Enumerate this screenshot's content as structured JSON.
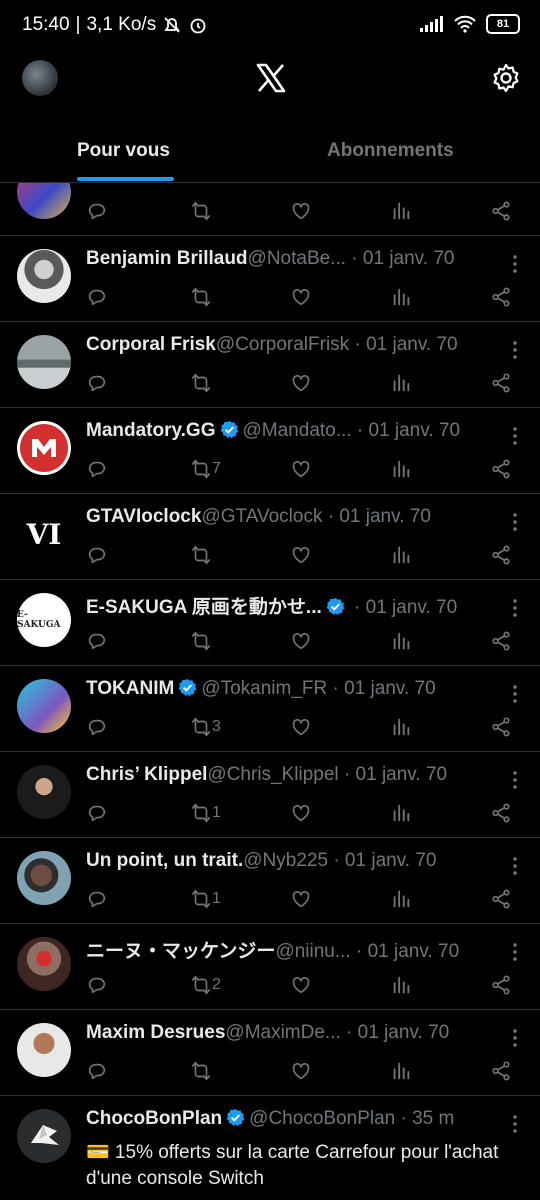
{
  "status_bar": {
    "time": "15:40",
    "network_speed": "3,1 Ko/s",
    "battery": "81"
  },
  "app": {
    "logo_icon": "x-logo",
    "settings_icon": "gear-icon"
  },
  "tabs": [
    {
      "label": "Pour vous",
      "active": true
    },
    {
      "label": "Abonnements",
      "active": false
    }
  ],
  "tweets": [
    {
      "name": "Benjamin Brillaud",
      "handle": "@NotaBe...",
      "date": " · 01 janv. 70",
      "retweets": ""
    },
    {
      "name": "Corporal Frisk",
      "handle": "@CorporalFrisk",
      "date": " · 01 janv. 70",
      "retweets": ""
    },
    {
      "name": "Mandatory.GG",
      "handle": "@Mandato...",
      "date": " · 01 janv. 70",
      "retweets": "7",
      "verified": true
    },
    {
      "name": "GTAVIoclock",
      "handle": "@GTAVoclock",
      "date": " · 01 janv. 70",
      "retweets": "",
      "avatar_text": "VI"
    },
    {
      "name": "E-SAKUGA 原画を動かせ...",
      "handle": "",
      "date": " · 01 janv. 70",
      "retweets": "",
      "verified": true,
      "avatar_text": "E-SAKUGA"
    },
    {
      "name": "TOKANIM",
      "handle": "@Tokanim_FR",
      "date": " · 01 janv. 70",
      "retweets": "3",
      "verified": true
    },
    {
      "name": "Chris’ Klippel",
      "handle": "@Chris_Klippel",
      "date": " · 01 janv. 70",
      "retweets": "1"
    },
    {
      "name": "Un point, un trait.",
      "handle": "@Nyb225",
      "date": " · 01 janv. 70",
      "retweets": "1"
    },
    {
      "name": "ニーヌ・マッケンジー",
      "handle": "@niinu...",
      "date": " · 01 janv. 70",
      "retweets": "2"
    },
    {
      "name": "Maxim Desrues",
      "handle": "@MaximDe...",
      "date": " · 01 janv. 70",
      "retweets": ""
    }
  ],
  "last_tweet": {
    "name": "ChocoBonPlan",
    "handle": "@ChocoBonPlan",
    "date": " · 35 m",
    "text": "💳 15% offerts sur la carte Carrefour pour l'achat d'une console Switch"
  }
}
